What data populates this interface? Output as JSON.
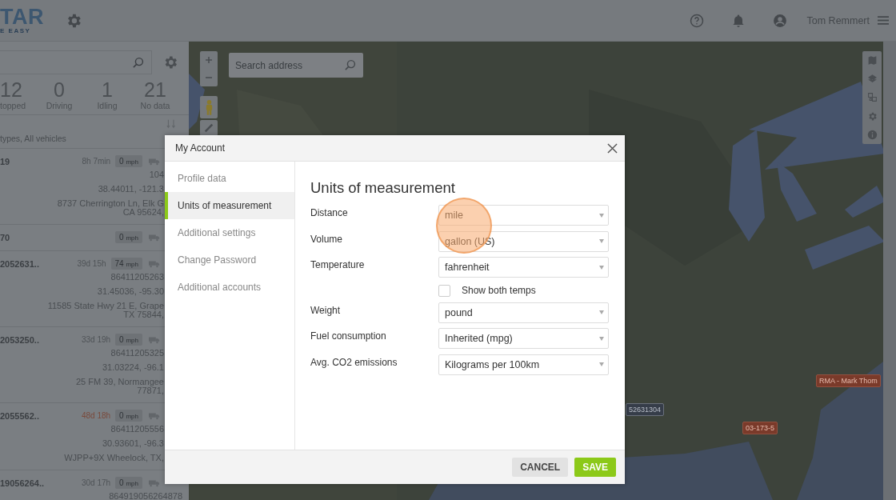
{
  "header": {
    "logo_text": "TAR",
    "logo_tagline": "E EASY",
    "user_name": "Tom Remmert"
  },
  "stats": [
    {
      "count": "12",
      "label": "topped"
    },
    {
      "count": "0",
      "label": "Driving"
    },
    {
      "count": "1",
      "label": "Idling"
    },
    {
      "count": "21",
      "label": "No data"
    }
  ],
  "filter_text": "types, All vehicles",
  "vehicles": [
    {
      "name": "19",
      "time": "8h 7min",
      "time_alert": false,
      "speed": "0",
      "speed_unit": "mph",
      "details": [
        "104",
        "38.44011, -121.3"
      ],
      "address": [
        "8737 Cherrington Ln, Elk G",
        "CA 95624,"
      ]
    },
    {
      "name": "70",
      "speed": "0",
      "speed_unit": "mph"
    },
    {
      "name": "2052631..",
      "time": "39d 15h",
      "time_alert": false,
      "speed": "74",
      "speed_unit": "mph",
      "details": [
        "86411205263",
        "31.45036, -95.30"
      ],
      "address": [
        "11585 State Hwy 21 E, Grape",
        "TX 75844,"
      ]
    },
    {
      "name": "2053250..",
      "time": "33d 19h",
      "time_alert": false,
      "speed": "0",
      "speed_unit": "mph",
      "details": [
        "86411205325",
        "31.03224, -96.1"
      ],
      "address": [
        "25 FM 39, Normangee",
        "77871,"
      ]
    },
    {
      "name": "2055562..",
      "time": "48d 18h",
      "time_alert": true,
      "speed": "0",
      "speed_unit": "mph",
      "details": [
        "86411205556",
        "30.93601, -96.3"
      ],
      "address": [
        "WJPP+9X Wheelock, TX,"
      ]
    },
    {
      "name": "19056264..",
      "time": "30d 17h",
      "time_alert": false,
      "speed": "0",
      "speed_unit": "mph",
      "details": [
        "864919056264878"
      ]
    }
  ],
  "map": {
    "search": {
      "placeholder": "Search address"
    },
    "markers": [
      {
        "label": "RMA - Mark Thom",
        "kind": "alert"
      },
      {
        "label": "03-173-5",
        "kind": "alert"
      },
      {
        "label": "52631304",
        "kind": "info"
      }
    ]
  },
  "dialog": {
    "title": "My Account",
    "nav": [
      {
        "label": "Profile data",
        "selected": false
      },
      {
        "label": "Units of measurement",
        "selected": true
      },
      {
        "label": "Additional settings",
        "selected": false
      },
      {
        "label": "Change Password",
        "selected": false
      },
      {
        "label": "Additional accounts",
        "selected": false
      }
    ],
    "heading": "Units of measurement",
    "fields": [
      {
        "kind": "select",
        "label": "Distance",
        "value": "mile"
      },
      {
        "kind": "select",
        "label": "Volume",
        "value": "gallon (US)"
      },
      {
        "kind": "select",
        "label": "Temperature",
        "value": "fahrenheit"
      },
      {
        "kind": "checkbox",
        "label": "Show both temps",
        "checked": false
      },
      {
        "kind": "select",
        "label": "Weight",
        "value": "pound"
      },
      {
        "kind": "select",
        "label": "Fuel consumption",
        "value": "Inherited (mpg)"
      },
      {
        "kind": "select",
        "label": "Avg. CO2 emissions",
        "value": "Kilograms per 100km"
      }
    ],
    "cancel": "CANCEL",
    "save": "SAVE"
  }
}
